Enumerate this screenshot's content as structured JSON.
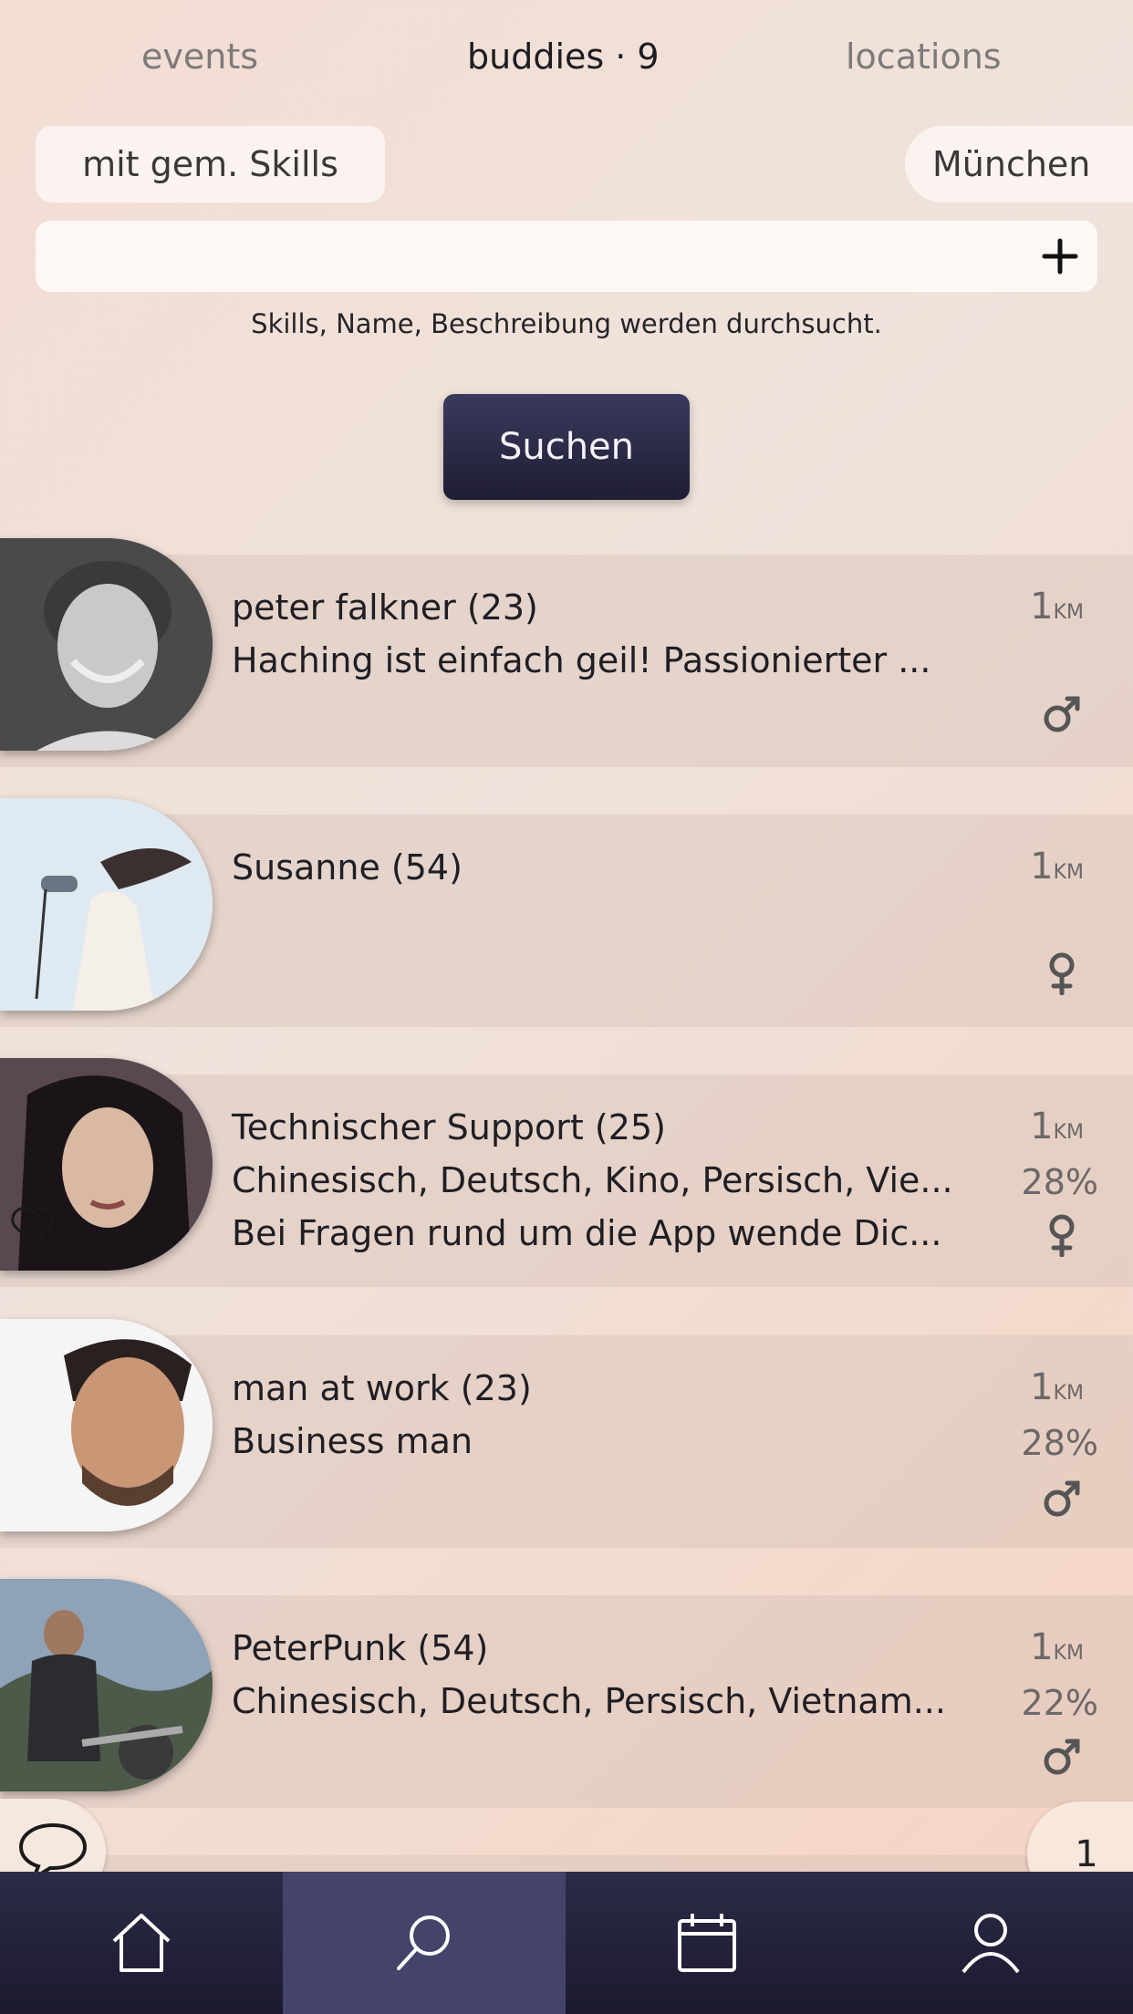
{
  "tabs": [
    {
      "label": "events"
    },
    {
      "label": "buddies · 9"
    },
    {
      "label": "locations"
    }
  ],
  "filters": {
    "skills_label": "mit gem. Skills",
    "city_label": "München"
  },
  "search": {
    "value": "",
    "hint": "Skills, Name, Beschreibung werden durchsucht.",
    "button_label": "Suchen"
  },
  "buddies": [
    {
      "title": "peter falkner (23)",
      "line2": "Haching ist einfach geil! Passionierter ...",
      "line3": "",
      "distance": "1",
      "unit": "KM",
      "match": "",
      "gender": "male",
      "avatar": "man-curly-hair"
    },
    {
      "title": "Susanne (54)",
      "line2": "",
      "line3": "",
      "distance": "1",
      "unit": "KM",
      "match": "",
      "gender": "female",
      "avatar": "woman-hairdryer"
    },
    {
      "title": "Technischer Support (25)",
      "line2": "Chinesisch, Deutsch, Kino, Persisch, Vie...",
      "line3": "Bei Fragen rund um die App wende Dic...",
      "distance": "1",
      "unit": "KM",
      "match": "28%",
      "gender": "female",
      "avatar": "woman-dark-hair"
    },
    {
      "title": "man at work (23)",
      "line2": "Business man",
      "line3": "",
      "distance": "1",
      "unit": "KM",
      "match": "28%",
      "gender": "male",
      "avatar": "man-beard"
    },
    {
      "title": "PeterPunk (54)",
      "line2": "Chinesisch, Deutsch, Persisch, Vietnam...",
      "line3": "",
      "distance": "1",
      "unit": "KM",
      "match": "22%",
      "gender": "male",
      "avatar": "man-motorcycle"
    }
  ],
  "page_badge": "1",
  "nav": [
    "home-icon",
    "search-icon",
    "calendar-icon",
    "user-icon"
  ],
  "colors": {
    "accent_dark": "#1e1d33",
    "nav_active": "#44446a"
  }
}
